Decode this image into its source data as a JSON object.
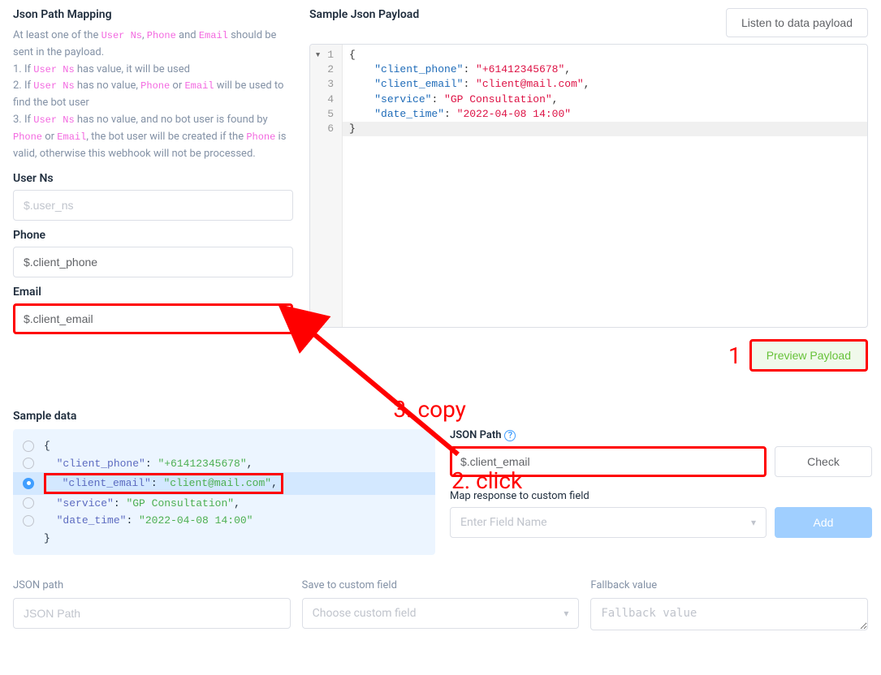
{
  "left": {
    "title": "Json Path Mapping",
    "help_line1_a": "At least one of the ",
    "help_line1_b": " and ",
    "help_line1_c": " should be sent in the payload.",
    "help_item1_a": "1. If ",
    "help_item1_b": " has value, it will be used",
    "help_item2_a": "2. If ",
    "help_item2_b": " has no value, ",
    "help_item2_c": " or ",
    "help_item2_d": " will be used to find the bot user",
    "help_item3_a": "3. If ",
    "help_item3_b": " has no value, and no bot user is found by ",
    "help_item3_c": " or ",
    "help_item3_d": ", the bot user will be created if the ",
    "help_item3_e": " is valid, otherwise this webhook will not be processed.",
    "code_userns": "User Ns",
    "code_phone": "Phone",
    "code_email": "Email",
    "userns_label": "User Ns",
    "userns_placeholder": "$.user_ns",
    "phone_label": "Phone",
    "phone_value": "$.client_phone",
    "email_label": "Email",
    "email_value": "$.client_email"
  },
  "right": {
    "title": "Sample Json Payload",
    "listen_btn": "Listen to data payload",
    "gutter": "1\n2\n3\n4\n5\n6",
    "code_lines": [
      {
        "type": "brace",
        "text": "{"
      },
      {
        "type": "kv",
        "indent": "    ",
        "key": "\"client_phone\"",
        "val": "\"+61412345678\"",
        "comma": ","
      },
      {
        "type": "kv",
        "indent": "    ",
        "key": "\"client_email\"",
        "val": "\"client@mail.com\"",
        "comma": ","
      },
      {
        "type": "kv",
        "indent": "    ",
        "key": "\"service\"",
        "val": "\"GP Consultation\"",
        "comma": ","
      },
      {
        "type": "kv",
        "indent": "    ",
        "key": "\"date_time\"",
        "val": "\"2022-04-08 14:00\"",
        "comma": ""
      },
      {
        "type": "brace",
        "text": "}"
      }
    ],
    "preview_btn": "Preview Payload"
  },
  "annotations": {
    "num1": "1",
    "click": "2. click",
    "copy": "3. copy"
  },
  "sample": {
    "title": "Sample data",
    "lines": [
      {
        "radio": "empty",
        "indent": "",
        "key": "",
        "val": "",
        "raw": "{",
        "selected": false,
        "highlighted": false
      },
      {
        "radio": "empty",
        "indent": "  ",
        "key": "\"client_phone\"",
        "val": "\"+61412345678\"",
        "comma": ",",
        "selected": false,
        "highlighted": false
      },
      {
        "radio": "checked",
        "indent": "  ",
        "key": "\"client_email\"",
        "val": "\"client@mail.com\"",
        "comma": ",",
        "selected": true,
        "highlighted": true
      },
      {
        "radio": "empty",
        "indent": "  ",
        "key": "\"service\"",
        "val": "\"GP Consultation\"",
        "comma": ",",
        "selected": false,
        "highlighted": false
      },
      {
        "radio": "empty",
        "indent": "  ",
        "key": "\"date_time\"",
        "val": "\"2022-04-08 14:00\"",
        "comma": "",
        "selected": false,
        "highlighted": false
      },
      {
        "radio": "spacer",
        "indent": "",
        "key": "",
        "val": "",
        "raw": "}",
        "selected": false,
        "highlighted": false
      }
    ]
  },
  "jsonpath": {
    "label": "JSON Path",
    "help": "?",
    "value": "$.client_email",
    "check_btn": "Check",
    "map_label": "Map response to custom field",
    "field_placeholder": "Enter Field Name",
    "add_btn": "Add"
  },
  "bottom": {
    "jsonpath_label": "JSON path",
    "jsonpath_placeholder": "JSON Path",
    "custom_label": "Save to custom field",
    "custom_placeholder": "Choose custom field",
    "fallback_label": "Fallback value",
    "fallback_placeholder": "Fallback value"
  }
}
